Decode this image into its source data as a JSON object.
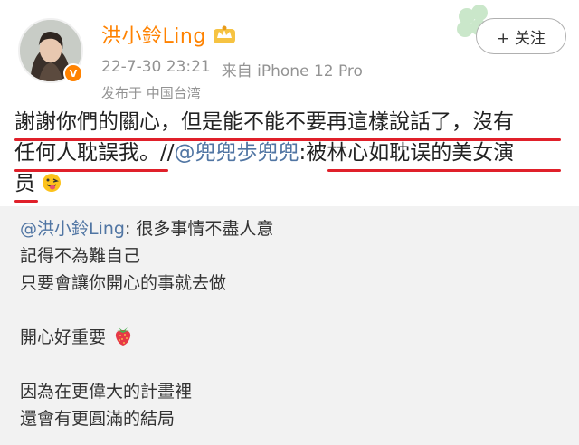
{
  "post": {
    "username": "洪小鈴Ling",
    "timestamp": "22-7-30 23:21",
    "source": "来自 iPhone 12 Pro",
    "location": "发布于  中国台湾",
    "follow_label": "+ 关注",
    "vip_badge": "V"
  },
  "content": {
    "line1": "謝謝你們的關心，但是能不能不要再這樣說話了，沒有",
    "line2_a": "任何人耽誤我。//",
    "line2_mention": "@兜兜歩兜兜",
    "line2_b": ":被林心如耽误的美女演",
    "line3": "员"
  },
  "retweet": {
    "mention": "@洪小鈴Ling",
    "line1_rest": ": 很多事情不盡人意",
    "line2": "記得不為難自己",
    "line3": "只要會讓你開心的事就去做",
    "line4": "開心好重要",
    "line5": "因為在更偉大的計畫裡",
    "line6": "還會有更圓滿的結局"
  },
  "colors": {
    "username": "#ff8200",
    "mention": "#5075a3",
    "underline": "#e0202a",
    "meta": "#939393",
    "retweet_bg": "#f2f2f2"
  },
  "icons": [
    "avatar",
    "vip-badge",
    "crown-icon",
    "clover-icon",
    "strawberry-emoji",
    "tongue-face-emoji"
  ]
}
